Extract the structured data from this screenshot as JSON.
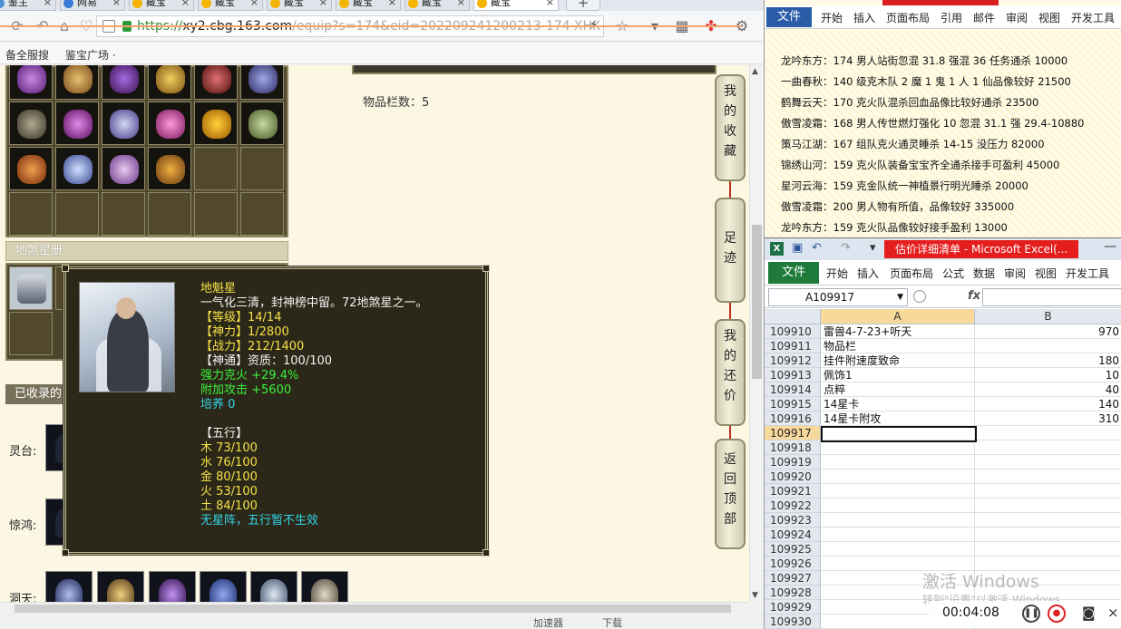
{
  "browser": {
    "tabs": [
      {
        "label": "鉴主"
      },
      {
        "label": "网易"
      },
      {
        "label": "藏宝"
      },
      {
        "label": "藏宝"
      },
      {
        "label": "藏宝"
      },
      {
        "label": "藏宝"
      },
      {
        "label": "藏宝"
      },
      {
        "label": "藏宝"
      }
    ],
    "newtab_label": "+",
    "url_scheme": "https://",
    "url_host": "xy2.cbg.163.com",
    "url_path": "/equip?s=174&eid=202209241200213-174-XHK",
    "bookmarks": [
      "备全服搜",
      "鉴宝广场 ·"
    ],
    "status": {
      "accelerator": "加速器",
      "download": "下载"
    }
  },
  "page": {
    "item_count_label": "物品栏数：5",
    "star_section_title": "地煞星册",
    "collected_title": "已收录的",
    "rows": [
      {
        "label": "灵台:"
      },
      {
        "label": "惊鸿:"
      },
      {
        "label": "洞天:"
      }
    ],
    "side_buttons": [
      {
        "label": "我的收藏"
      },
      {
        "label": "足迹"
      },
      {
        "label": "我的还价"
      },
      {
        "label": "返回顶部"
      }
    ]
  },
  "tooltip": {
    "name": "地魁星",
    "desc": "一气化三清，封神榜中留。72地煞星之一。",
    "level": "【等级】14/14",
    "shenli": "【神力】1/2800",
    "zhanli": "【战力】212/1400",
    "shentong": "【神通】资质：100/100",
    "stat1": "强力克火 +29.4%",
    "stat2": "附加攻击 +5600",
    "peiyang": "培养 0",
    "wuxing_title": "【五行】",
    "wuxing": [
      "木 73/100",
      "水 76/100",
      "金 80/100",
      "火 53/100",
      "土 84/100"
    ],
    "footer": "无星阵，五行暂不生效"
  },
  "word": {
    "file_tab": "文件",
    "menu": [
      "开始",
      "插入",
      "页面布局",
      "引用",
      "邮件",
      "审阅",
      "视图",
      "开发工具"
    ],
    "lines": [
      "龙吟东方：174 男人站街忽混 31.8 强混 36 任务通杀 10000",
      "一曲春秋：140 级克木队 2 魔 1 鬼 1 人 1 仙品像较好 21500",
      "鹤舞云天：170 克火队混杀回血品像比较好通杀 23500",
      "傲雪凌霜：168 男人传世燃灯强化 10 忽混 31.1 强 29.4-10880",
      "策马江湖：167 组队克火通灵睡杀 14-15 没压力 82000",
      "锦绣山河：159 克火队装备宝宝齐全通杀接手可盈利 45000",
      "星河云海：159 克金队统一神植景行明光睡杀 20000",
      "傲雪凌霜：200 男人物有所值，品像较好 335000",
      "龙吟东方：159 克火队品像较好接手盈利 13000"
    ]
  },
  "excel": {
    "title": "估价详细清单 - Microsoft Excel(...",
    "file_tab": "文件",
    "menu": [
      "开始",
      "插入",
      "页面布局",
      "公式",
      "数据",
      "审阅",
      "视图",
      "开发工具"
    ],
    "namebox": "A109917",
    "fx": "fx",
    "col_a": "A",
    "col_b": "B",
    "rows": [
      {
        "n": "109910",
        "a": "雷兽4-7-23+听天",
        "b": "970"
      },
      {
        "n": "109911",
        "a": "物品栏",
        "b": ""
      },
      {
        "n": "109912",
        "a": "挂件附速度致命",
        "b": "180"
      },
      {
        "n": "109913",
        "a": "佩饰1",
        "b": "10"
      },
      {
        "n": "109914",
        "a": "点粹",
        "b": "40"
      },
      {
        "n": "109915",
        "a": "14星卡",
        "b": "140"
      },
      {
        "n": "109916",
        "a": "14星卡附攻",
        "b": "310"
      },
      {
        "n": "109917",
        "a": "",
        "b": ""
      },
      {
        "n": "109918",
        "a": "",
        "b": ""
      },
      {
        "n": "109919",
        "a": "",
        "b": ""
      },
      {
        "n": "109920",
        "a": "",
        "b": ""
      },
      {
        "n": "109921",
        "a": "",
        "b": ""
      },
      {
        "n": "109922",
        "a": "",
        "b": ""
      },
      {
        "n": "109923",
        "a": "",
        "b": ""
      },
      {
        "n": "109924",
        "a": "",
        "b": ""
      },
      {
        "n": "109925",
        "a": "",
        "b": ""
      },
      {
        "n": "109926",
        "a": "",
        "b": ""
      },
      {
        "n": "109927",
        "a": "",
        "b": ""
      },
      {
        "n": "109928",
        "a": "",
        "b": ""
      },
      {
        "n": "109929",
        "a": "",
        "b": ""
      },
      {
        "n": "109930",
        "a": "",
        "b": ""
      }
    ],
    "watermark": "激活 Windows",
    "watermark_sub": "转到\"设置\"以激活 Windows。",
    "recorder_time": "00:04:08"
  }
}
